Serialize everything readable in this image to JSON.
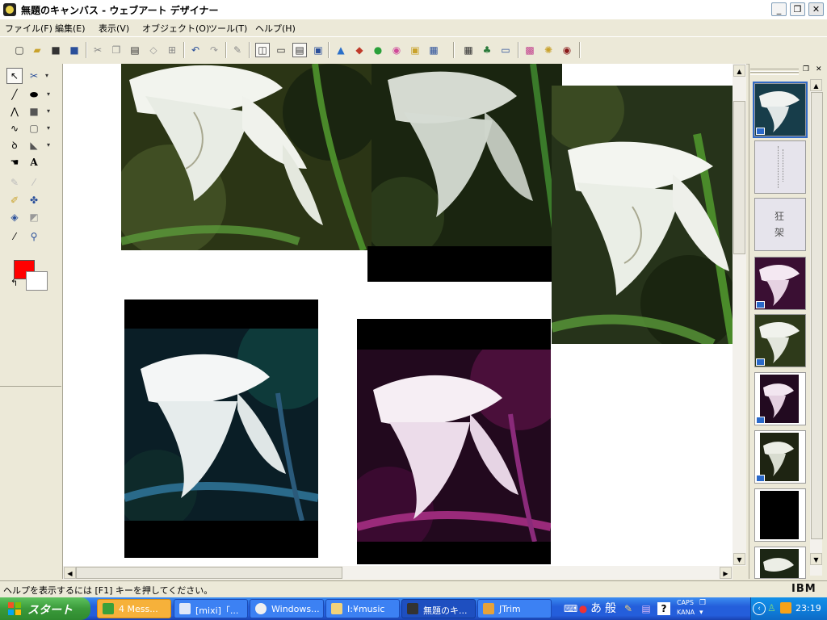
{
  "window": {
    "title": "無題のキャンバス - ウェブアート デザイナー",
    "minimize": "_",
    "restore": "❐",
    "close": "✕"
  },
  "menu": [
    "ファイル(F)",
    "編集(E)",
    "表示(V)",
    "オブジェクト(O)",
    "ツール(T)",
    "ヘルプ(H)"
  ],
  "toolbar_icons": [
    "new-icon",
    "open-icon",
    "save-icon",
    "save-as-icon",
    "cut-icon",
    "copy-icon",
    "paste-icon",
    "eraser-icon",
    "grid-icon",
    "undo-icon",
    "redo-icon",
    "edit-icon",
    "view-mode-1-icon",
    "view-mode-2-icon",
    "view-mode-3-icon",
    "view-mode-4-icon",
    "image-icon",
    "cube-icon",
    "shapes-icon",
    "stamp-icon",
    "frame-icon",
    "screen-icon",
    "tile-icon",
    "tree-icon",
    "picture-icon",
    "color-icon",
    "brightness-icon",
    "eye-icon"
  ],
  "palette": {
    "text_tool": "A",
    "foreground_color": "#ff0000",
    "background_color": "#ffffff"
  },
  "canvas": {
    "photos": [
      {
        "name": "lily-photo-natural",
        "tint": "#4a5a2a",
        "bg": "#2b3515"
      },
      {
        "name": "lily-photo-blur",
        "tint": "#2a3a1a",
        "bg": "#1a2510"
      },
      {
        "name": "lily-photo-large",
        "tint": "#3a4a22",
        "bg": "#26331a"
      },
      {
        "name": "lily-photo-cyan",
        "tint": "#0e3a3a",
        "bg": "#0a1e26"
      },
      {
        "name": "lily-photo-magenta",
        "tint": "#4a0f3a",
        "bg": "#22091e"
      }
    ]
  },
  "gallery": {
    "thumb_text_1": "狂 架",
    "thumbs": [
      {
        "name": "gallery-thumb-natural",
        "bg": "#173d4a"
      },
      {
        "name": "gallery-thumb-text-vertical",
        "bg": "#e6e4ec"
      },
      {
        "name": "gallery-thumb-text-kanji",
        "bg": "#e6e4ec"
      },
      {
        "name": "gallery-thumb-magenta",
        "bg": "#3a0f33"
      },
      {
        "name": "gallery-thumb-green",
        "bg": "#2e3a1a"
      },
      {
        "name": "gallery-thumb-magenta-dark",
        "bg": "#220a20"
      },
      {
        "name": "gallery-thumb-olive",
        "bg": "#1e2412"
      },
      {
        "name": "gallery-thumb-black",
        "bg": "#000000"
      },
      {
        "name": "gallery-thumb-bottom",
        "bg": "#1c2614"
      }
    ]
  },
  "status": {
    "help_text": "ヘルプを表示するには [F1] キーを押してください。",
    "brand": "IBM"
  },
  "taskbar": {
    "start_label": "スタート",
    "tasks": [
      {
        "label": "4 Mess...",
        "kind": "msg"
      },
      {
        "label": "[mixi]「...",
        "kind": "normal"
      },
      {
        "label": "Windows...",
        "kind": "normal"
      },
      {
        "label": "I:¥music",
        "kind": "normal"
      },
      {
        "label": "無題のキ...",
        "kind": "active"
      },
      {
        "label": "JTrim",
        "kind": "normal"
      }
    ],
    "ime_a": "あ",
    "ime_mode": "般",
    "caps": "CAPS",
    "kana": "KANA",
    "clock": "23:19"
  }
}
